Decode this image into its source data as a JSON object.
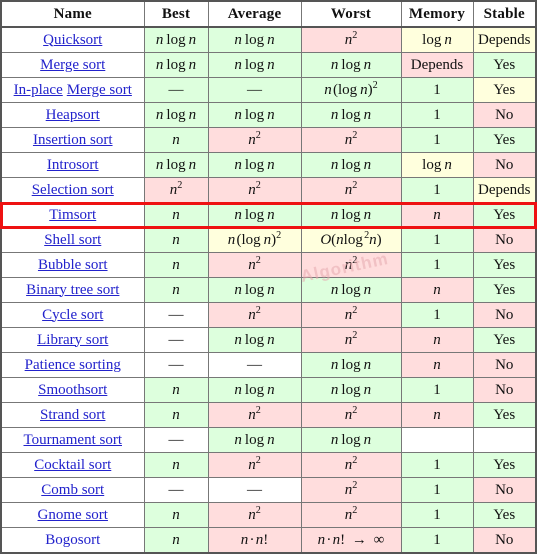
{
  "table": {
    "columns": [
      "Name",
      "Best",
      "Average",
      "Worst",
      "Memory",
      "Stable"
    ],
    "highlighted_row": "Timsort",
    "highlight_color": "#ee1111",
    "colors": {
      "good": "#ddffdd",
      "bad": "#ffdddd",
      "medium": "#ffffdd",
      "none": "#ffffff",
      "link": "#2222cc",
      "border": "#777777",
      "outer_border": "#555555"
    },
    "watermark": "Algorithm",
    "rows": [
      {
        "name": [
          "Quicksort"
        ],
        "link": true,
        "best": "n log n",
        "best_bg": "good",
        "average": "n log n",
        "average_bg": "good",
        "worst": "n^2",
        "worst_bg": "bad",
        "memory": "log n",
        "memory_bg": "medium",
        "stable": "Depends",
        "stable_bg": "medium"
      },
      {
        "name": [
          "Merge sort"
        ],
        "link": true,
        "best": "n log n",
        "best_bg": "good",
        "average": "n log n",
        "average_bg": "good",
        "worst": "n log n",
        "worst_bg": "good",
        "memory": "Depends",
        "memory_bg": "bad",
        "stable": "Yes",
        "stable_bg": "good"
      },
      {
        "name": [
          "In-place",
          "Merge sort"
        ],
        "link": true,
        "best": "—",
        "best_bg": "good",
        "average": "—",
        "average_bg": "good",
        "worst": "n (log n)^2",
        "worst_bg": "good",
        "memory": "1",
        "memory_bg": "good",
        "stable": "Yes",
        "stable_bg": "medium"
      },
      {
        "name": [
          "Heapsort"
        ],
        "link": true,
        "best": "n log n",
        "best_bg": "good",
        "average": "n log n",
        "average_bg": "good",
        "worst": "n log n",
        "worst_bg": "good",
        "memory": "1",
        "memory_bg": "good",
        "stable": "No",
        "stable_bg": "bad"
      },
      {
        "name": [
          "Insertion sort"
        ],
        "link": true,
        "best": "n",
        "best_bg": "good",
        "average": "n^2",
        "average_bg": "bad",
        "worst": "n^2",
        "worst_bg": "bad",
        "memory": "1",
        "memory_bg": "good",
        "stable": "Yes",
        "stable_bg": "good"
      },
      {
        "name": [
          "Introsort"
        ],
        "link": true,
        "best": "n log n",
        "best_bg": "good",
        "average": "n log n",
        "average_bg": "good",
        "worst": "n log n",
        "worst_bg": "good",
        "memory": "log n",
        "memory_bg": "medium",
        "stable": "No",
        "stable_bg": "bad"
      },
      {
        "name": [
          "Selection sort"
        ],
        "link": true,
        "best": "n^2",
        "best_bg": "bad",
        "average": "n^2",
        "average_bg": "bad",
        "worst": "n^2",
        "worst_bg": "bad",
        "memory": "1",
        "memory_bg": "good",
        "stable": "Depends",
        "stable_bg": "medium"
      },
      {
        "name": [
          "Timsort"
        ],
        "link": true,
        "best": "n",
        "best_bg": "good",
        "average": "n log n",
        "average_bg": "good",
        "worst": "n log n",
        "worst_bg": "good",
        "memory": "n",
        "memory_bg": "bad",
        "stable": "Yes",
        "stable_bg": "good"
      },
      {
        "name": [
          "Shell sort"
        ],
        "link": true,
        "best": "n",
        "best_bg": "good",
        "average": "n(log n)^2",
        "average_bg": "medium",
        "worst": "O(n log ^2 n)",
        "worst_bg": "medium",
        "memory": "1",
        "memory_bg": "good",
        "stable": "No",
        "stable_bg": "bad"
      },
      {
        "name": [
          "Bubble sort"
        ],
        "link": true,
        "best": "n",
        "best_bg": "good",
        "average": "n^2",
        "average_bg": "bad",
        "worst": "n^2",
        "worst_bg": "bad",
        "memory": "1",
        "memory_bg": "good",
        "stable": "Yes",
        "stable_bg": "good"
      },
      {
        "name": [
          "Binary tree sort"
        ],
        "link": true,
        "best": "n",
        "best_bg": "good",
        "average": "n log n",
        "average_bg": "good",
        "worst": "n log n",
        "worst_bg": "good",
        "memory": "n",
        "memory_bg": "bad",
        "stable": "Yes",
        "stable_bg": "good"
      },
      {
        "name": [
          "Cycle sort"
        ],
        "link": true,
        "best": "—",
        "best_bg": "none",
        "average": "n^2",
        "average_bg": "bad",
        "worst": "n^2",
        "worst_bg": "bad",
        "memory": "1",
        "memory_bg": "good",
        "stable": "No",
        "stable_bg": "bad"
      },
      {
        "name": [
          "Library sort"
        ],
        "link": true,
        "best": "—",
        "best_bg": "none",
        "average": "n log n",
        "average_bg": "good",
        "worst": "n^2",
        "worst_bg": "bad",
        "memory": "n",
        "memory_bg": "bad",
        "stable": "Yes",
        "stable_bg": "good"
      },
      {
        "name": [
          "Patience sorting"
        ],
        "link": true,
        "best": "—",
        "best_bg": "none",
        "average": "—",
        "average_bg": "none",
        "worst": "n log n",
        "worst_bg": "good",
        "memory": "n",
        "memory_bg": "bad",
        "stable": "No",
        "stable_bg": "bad"
      },
      {
        "name": [
          "Smoothsort"
        ],
        "link": true,
        "best": "n",
        "best_bg": "good",
        "average": "n log n",
        "average_bg": "good",
        "worst": "n log n",
        "worst_bg": "good",
        "memory": "1",
        "memory_bg": "good",
        "stable": "No",
        "stable_bg": "bad"
      },
      {
        "name": [
          "Strand sort"
        ],
        "link": true,
        "best": "n",
        "best_bg": "good",
        "average": "n^2",
        "average_bg": "bad",
        "worst": "n^2",
        "worst_bg": "bad",
        "memory": "n",
        "memory_bg": "bad",
        "stable": "Yes",
        "stable_bg": "good"
      },
      {
        "name": [
          "Tournament sort"
        ],
        "link": true,
        "best": "—",
        "best_bg": "none",
        "average": "n log n",
        "average_bg": "good",
        "worst": "n log n",
        "worst_bg": "good",
        "memory": "",
        "memory_bg": "none",
        "stable": "",
        "stable_bg": "none"
      },
      {
        "name": [
          "Cocktail sort"
        ],
        "link": true,
        "best": "n",
        "best_bg": "good",
        "average": "n^2",
        "average_bg": "bad",
        "worst": "n^2",
        "worst_bg": "bad",
        "memory": "1",
        "memory_bg": "good",
        "stable": "Yes",
        "stable_bg": "good"
      },
      {
        "name": [
          "Comb sort"
        ],
        "link": true,
        "best": "—",
        "best_bg": "none",
        "average": "—",
        "average_bg": "none",
        "worst": "n^2",
        "worst_bg": "bad",
        "memory": "1",
        "memory_bg": "good",
        "stable": "No",
        "stable_bg": "bad"
      },
      {
        "name": [
          "Gnome sort"
        ],
        "link": true,
        "best": "n",
        "best_bg": "good",
        "average": "n^2",
        "average_bg": "bad",
        "worst": "n^2",
        "worst_bg": "bad",
        "memory": "1",
        "memory_bg": "good",
        "stable": "Yes",
        "stable_bg": "good"
      },
      {
        "name": [
          "Bogosort"
        ],
        "link": false,
        "best": "n",
        "best_bg": "good",
        "average": "n · n!",
        "average_bg": "bad",
        "worst": "n · n! → ∞",
        "worst_bg": "bad",
        "memory": "1",
        "memory_bg": "good",
        "stable": "No",
        "stable_bg": "bad"
      }
    ]
  }
}
